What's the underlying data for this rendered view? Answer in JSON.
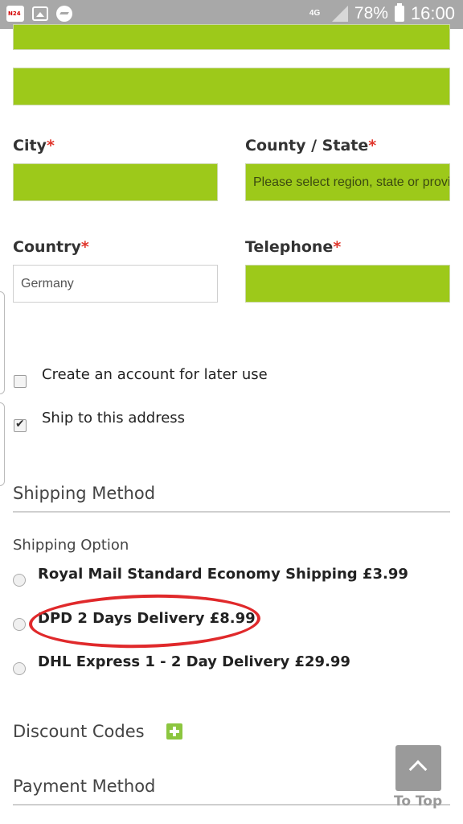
{
  "status_bar": {
    "network": "4G",
    "battery": "78%",
    "time": "16:00",
    "icons": [
      "news-app-icon",
      "gallery-icon",
      "messenger-icon",
      "signal-icon",
      "battery-icon"
    ]
  },
  "form": {
    "city": {
      "label": "City",
      "required_mark": "*",
      "value": ""
    },
    "county": {
      "label": "County / State",
      "required_mark": "*",
      "placeholder": "Please select region, state or province"
    },
    "country": {
      "label": "Country",
      "required_mark": "*",
      "value": "Germany"
    },
    "telephone": {
      "label": "Telephone",
      "required_mark": "*",
      "value": ""
    },
    "create_account": {
      "label": "Create an account for later use",
      "checked": false
    },
    "ship_to_address": {
      "label": "Ship to this address",
      "checked": true
    }
  },
  "shipping": {
    "title": "Shipping Method",
    "option_label": "Shipping Option",
    "options": [
      {
        "label": "Royal Mail Standard Economy Shipping",
        "price": "£3.99"
      },
      {
        "label": "DPD 2 Days Delivery",
        "price": "£8.99"
      },
      {
        "label": "DHL Express 1 - 2 Day Delivery",
        "price": "£29.99"
      }
    ]
  },
  "discount": {
    "title": "Discount Codes"
  },
  "payment": {
    "title": "Payment Method"
  },
  "to_top": {
    "label": "To Top"
  },
  "colors": {
    "field_green": "#9dc91a",
    "required": "#e0352b",
    "annotation_red": "#e0292b"
  }
}
